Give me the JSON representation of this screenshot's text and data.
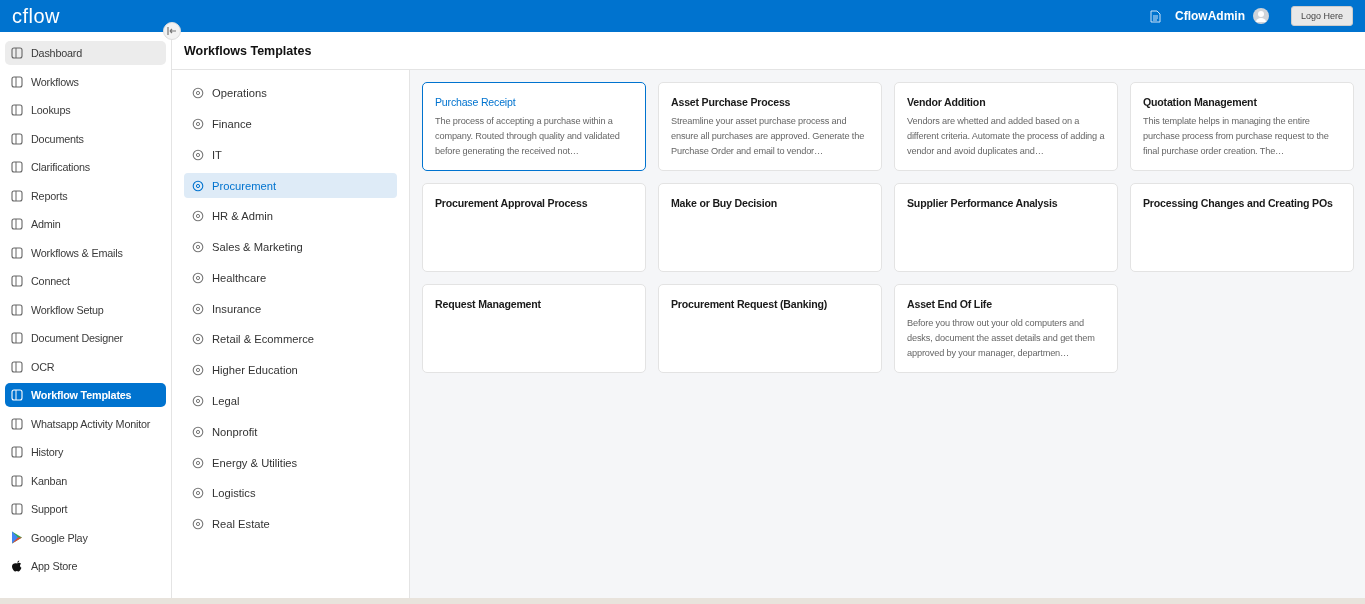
{
  "header": {
    "logo": "cflow",
    "user": "CflowAdmin",
    "logo_button": "Logo Here"
  },
  "sidebar": {
    "items": [
      {
        "label": "Dashboard",
        "kind": "nav",
        "selected": false,
        "highlighted": true
      },
      {
        "label": "Workflows",
        "kind": "nav",
        "selected": false,
        "highlighted": false
      },
      {
        "label": "Lookups",
        "kind": "nav",
        "selected": false,
        "highlighted": false
      },
      {
        "label": "Documents",
        "kind": "nav",
        "selected": false,
        "highlighted": false
      },
      {
        "label": "Clarifications",
        "kind": "nav",
        "selected": false,
        "highlighted": false
      },
      {
        "label": "Reports",
        "kind": "nav",
        "selected": false,
        "highlighted": false
      },
      {
        "label": "Admin",
        "kind": "nav",
        "selected": false,
        "highlighted": false
      },
      {
        "label": "Workflows & Emails",
        "kind": "nav",
        "selected": false,
        "highlighted": false
      },
      {
        "label": "Connect",
        "kind": "nav",
        "selected": false,
        "highlighted": false
      },
      {
        "label": "Workflow Setup",
        "kind": "nav",
        "selected": false,
        "highlighted": false
      },
      {
        "label": "Document Designer",
        "kind": "nav",
        "selected": false,
        "highlighted": false
      },
      {
        "label": "OCR",
        "kind": "nav",
        "selected": false,
        "highlighted": false
      },
      {
        "label": "Workflow Templates",
        "kind": "nav",
        "selected": true,
        "highlighted": false
      },
      {
        "label": "Whatsapp Activity Monitor",
        "kind": "nav",
        "selected": false,
        "highlighted": false
      },
      {
        "label": "History",
        "kind": "nav",
        "selected": false,
        "highlighted": false
      },
      {
        "label": "Kanban",
        "kind": "nav",
        "selected": false,
        "highlighted": false
      },
      {
        "label": "Support",
        "kind": "nav",
        "selected": false,
        "highlighted": false
      },
      {
        "label": "Google Play",
        "kind": "play",
        "selected": false,
        "highlighted": false
      },
      {
        "label": "App Store",
        "kind": "apple",
        "selected": false,
        "highlighted": false
      }
    ]
  },
  "page_title": "Workflows Templates",
  "categories": [
    {
      "label": "Operations",
      "selected": false
    },
    {
      "label": "Finance",
      "selected": false
    },
    {
      "label": "IT",
      "selected": false
    },
    {
      "label": "Procurement",
      "selected": true
    },
    {
      "label": "HR & Admin",
      "selected": false
    },
    {
      "label": "Sales & Marketing",
      "selected": false
    },
    {
      "label": "Healthcare",
      "selected": false
    },
    {
      "label": "Insurance",
      "selected": false
    },
    {
      "label": "Retail & Ecommerce",
      "selected": false
    },
    {
      "label": "Higher Education",
      "selected": false
    },
    {
      "label": "Legal",
      "selected": false
    },
    {
      "label": "Nonprofit",
      "selected": false
    },
    {
      "label": "Energy & Utilities",
      "selected": false
    },
    {
      "label": "Logistics",
      "selected": false
    },
    {
      "label": "Real Estate",
      "selected": false
    }
  ],
  "templates": [
    {
      "title": "Purchase Receipt",
      "description": "The process of accepting a purchase within a company. Routed through quality and validated before generating the received not…",
      "selected": true
    },
    {
      "title": "Asset Purchase Process",
      "description": "Streamline your asset purchase process and ensure all purchases are approved. Generate the Purchase Order and email to vendor…",
      "selected": false
    },
    {
      "title": "Vendor Addition",
      "description": "Vendors are whetted and added based on a different criteria. Automate the process of adding a vendor and avoid duplicates and…",
      "selected": false
    },
    {
      "title": "Quotation Management",
      "description": "This template helps in managing the entire purchase process from purchase request to the final purchase order creation. The…",
      "selected": false
    },
    {
      "title": "Procurement Approval Process",
      "selected": false
    },
    {
      "title": "Make or Buy Decision",
      "selected": false
    },
    {
      "title": "Supplier Performance Analysis",
      "selected": false
    },
    {
      "title": "Processing Changes and Creating POs",
      "selected": false
    },
    {
      "title": "Request Management",
      "selected": false
    },
    {
      "title": "Procurement Request (Banking)",
      "selected": false
    },
    {
      "title": "Asset End Of Life",
      "description": "Before you throw out your old computers and desks, document the asset details and get them approved by your manager, departmen…",
      "selected": false
    }
  ]
}
